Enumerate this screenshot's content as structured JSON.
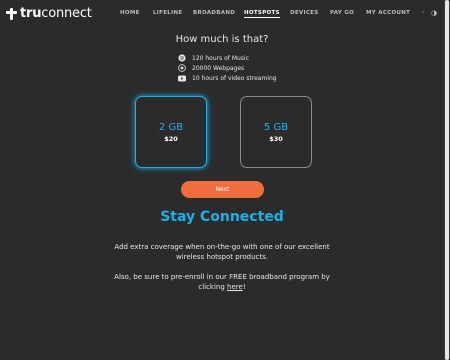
{
  "header": {
    "logo": {
      "bold": "tru",
      "regular": "connect"
    },
    "nav": [
      {
        "label": "HOME",
        "active": false
      },
      {
        "label": "LIFELINE",
        "active": false
      },
      {
        "label": "BROADBAND",
        "active": false
      },
      {
        "label": "HOTSPOTS",
        "active": true
      },
      {
        "label": "DEVICES",
        "active": false
      },
      {
        "label": "PAY GO",
        "active": false
      },
      {
        "label": "MY ACCOUNT",
        "active": false
      }
    ],
    "icons": [
      "settings-dot-icon",
      "theme-toggle-icon"
    ]
  },
  "main": {
    "title": "How much is that?",
    "features": [
      {
        "icon": "music-icon",
        "text": "120 hours of Music"
      },
      {
        "icon": "globe-icon",
        "text": "20000 Webpages"
      },
      {
        "icon": "video-icon",
        "text": "10 hours of video streaming"
      }
    ],
    "plans": [
      {
        "size": "2 GB",
        "price": "$20",
        "selected": true
      },
      {
        "size": "5 GB",
        "price": "$30",
        "selected": false
      }
    ],
    "next_label": "Next",
    "headline": "Stay Connected",
    "paragraph1": "Add extra coverage when on-the-go with one of our excellent wireless hotspot products.",
    "paragraph2_prefix": "Also, be sure to pre-enroll in our FREE broadband program by clicking ",
    "paragraph2_link": "here",
    "paragraph2_suffix": "!"
  },
  "colors": {
    "accent": "#19b2e8",
    "button": "#f26d3d",
    "background": "#2b2b2b"
  }
}
